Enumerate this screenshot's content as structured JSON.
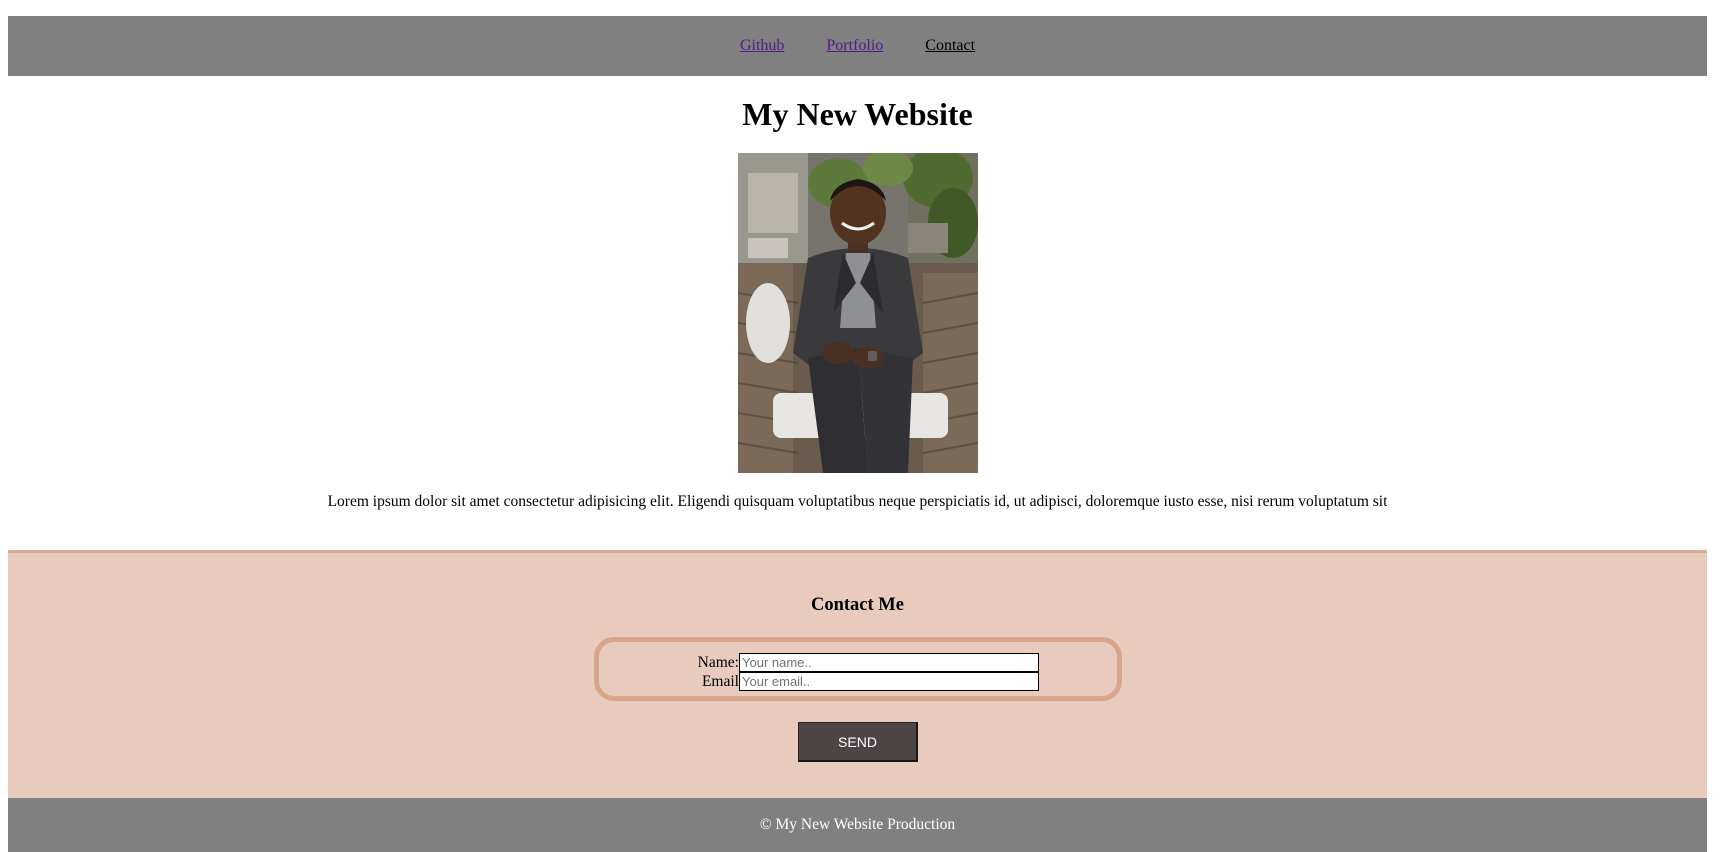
{
  "nav": {
    "links": [
      {
        "label": "Github"
      },
      {
        "label": "Portfolio"
      },
      {
        "label": "Contact"
      }
    ]
  },
  "header": {
    "title": "My New Website"
  },
  "profile": {
    "photo_alt": "Portrait of a smiling man in a dark suit seated in a wicker chair"
  },
  "intro": {
    "text": "Lorem ipsum dolor sit amet consectetur adipisicing elit. Eligendi quisquam voluptatibus neque perspiciatis id, ut adipisci, doloremque iusto esse, nisi rerum voluptatum sit"
  },
  "contact": {
    "heading": "Contact Me",
    "name_label": "Name:",
    "name_placeholder": "Your name..",
    "email_label": "Email",
    "email_placeholder": "Your email..",
    "send_label": "SEND"
  },
  "footer": {
    "text": "© My New Website Production"
  },
  "colors": {
    "nav_bg": "#808080",
    "contact_bg": "#e8cbbd",
    "form_border": "#d6a58c",
    "button_bg": "#4d4545",
    "footer_bg": "#808080"
  }
}
